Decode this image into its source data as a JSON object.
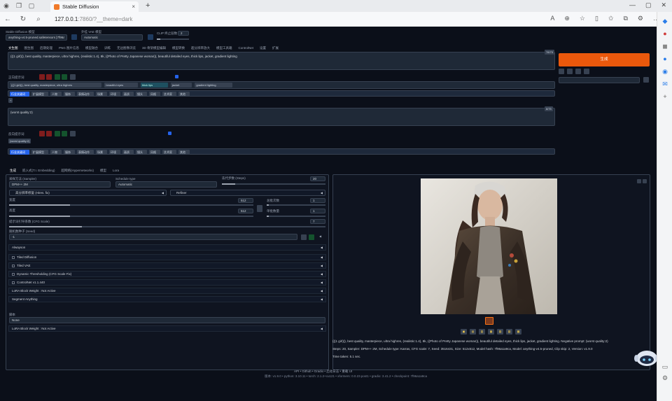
{
  "browser": {
    "tab_title": "Stable Diffusion",
    "url_host": "127.0.0.1",
    "url_rest": ":7860/?__theme=dark"
  },
  "top": {
    "checkpoint_label": "Stable Diffusion 模型",
    "checkpoint_value": "anything-v4.5-pruned.safetensors [7f96a1a9ca]",
    "vae_label": "外挂 VAE 模型",
    "vae_value": "Automatic",
    "clip_label": "CLIP 终止层数",
    "clip_value": "2"
  },
  "main_tabs": [
    "文生图",
    "图生图",
    "后期处理",
    "PNG 图片信息",
    "模型融合",
    "训练",
    "无边图像浏览",
    "3D 骨架模型编辑",
    "模型转换",
    "超分辨率放大",
    "模型工具箱",
    "ControlNet",
    "设置",
    "扩展"
  ],
  "prompt": {
    "text": "(((1 girl))), best quality, masterpiece, ultra highres, (realistic:1.4), 8k, ((Photo of Pretty Japanese woman)), beautiful detailed eyes, thick lips, jacket, gradient lighting",
    "token_count": "78/75"
  },
  "neg_prompt": {
    "text": "(worst quality:2)",
    "token_count": "8/75"
  },
  "generate_label": "生成",
  "tag_area": {
    "label_pos": "正向提示词",
    "label_neg": "反向提示词",
    "chips_pos": [
      "(((1 girl))), best quality, masterpiece, ultra highres",
      "beautiful eyes",
      "thick lips",
      "jacket",
      "gradient lighting"
    ],
    "chip_tags": [
      "行业关键词",
      "扩展模型",
      "人物",
      "服饰",
      "表情动作",
      "场景",
      "环境",
      "画质",
      "镜头",
      "风格",
      "艺术家",
      "其他"
    ],
    "chips_neg": [
      "(worst quality:2)"
    ]
  },
  "sub_tabs": [
    "生成",
    "嵌入式(T.I. Embedding)",
    "超网络(Hypernetworks)",
    "模型",
    "Lora"
  ],
  "settings": {
    "sampler_label": "采样方法 (Sampler)",
    "sampler_value": "DPM++ 2M",
    "schedule_label": "Schedule type",
    "schedule_value": "Automatic",
    "steps_label": "迭代步数 (Steps)",
    "steps_value": "20",
    "hires_label": "高分辨率修复 (Hires. fix)",
    "refiner_label": "Refiner",
    "width_label": "宽度",
    "width_value": "512",
    "height_label": "高度",
    "height_value": "512",
    "batch_count_label": "总批次数",
    "batch_count_value": "1",
    "batch_size_label": "单批数量",
    "batch_size_value": "1",
    "cfg_label": "提示词引导系数 (CFG Scale)",
    "cfg_value": "7",
    "seed_label": "随机数种子 (Seed)",
    "seed_value": "-1",
    "accordions": [
      "Alwayson",
      "Tiled Diffusion",
      "Tiled VAE",
      "Dynamic Thresholding (CFG Scale Fix)",
      "ControlNet v1.1.440",
      "LoRA Block Weight : Not Active",
      "Segment Anything"
    ],
    "accordions_cb": [
      false,
      true,
      true,
      true,
      true,
      false,
      false,
      false
    ],
    "script_label": "脚本",
    "script_value": "None",
    "last_accordion": "LoRA Block Weight : Not Active"
  },
  "output": {
    "info": "(((1 girl))), best quality, masterpiece, ultra highres, (realistic:1.4), 8k, ((Photo of Pretty Japanese woman)), beautiful detailed eyes, thick lips, jacket, gradient lighting. Negative prompt: (worst quality:2)",
    "params": "Steps: 20, Sampler: DPM++ 2M, Schedule type: Karras, CFG scale: 7, Seed: 3516431, Size: 512x512, Model hash: 7f96a1a9ca, Model: anything-v4.5-pruned, Clip skip: 2, Version: v1.9.0",
    "time": "Time taken: 5.1 sec."
  },
  "footer": {
    "links": "API  •  Github  •  Gradio  •  启动日志  •  重载 UI",
    "versions": "版本: v1.9.0  •  python: 3.10.11  •  torch: 2.1.2+cu121  •  xformers: 0.0.23.post1  •  gradio: 3.41.2  •  checkpoint: 7f96a1a9ca"
  }
}
